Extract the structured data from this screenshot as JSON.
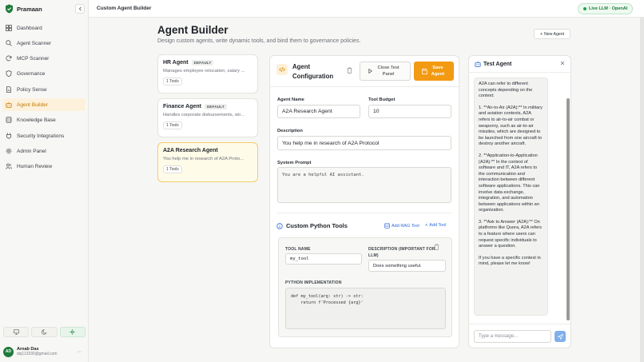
{
  "app": {
    "name": "Pramaan"
  },
  "sidebar": {
    "items": [
      {
        "label": "Dashboard",
        "icon": "dashboard-icon"
      },
      {
        "label": "Agent Scanner",
        "icon": "search-icon"
      },
      {
        "label": "MCP Scanner",
        "icon": "refresh-icon"
      },
      {
        "label": "Governance",
        "icon": "shield-icon"
      },
      {
        "label": "Policy Sense",
        "icon": "document-icon"
      },
      {
        "label": "Agent Builder",
        "icon": "bot-icon",
        "active": true
      },
      {
        "label": "Knowledge Base",
        "icon": "database-icon"
      },
      {
        "label": "Security Integrations",
        "icon": "plug-icon"
      },
      {
        "label": "Admin Panel",
        "icon": "gear-icon"
      },
      {
        "label": "Human Review",
        "icon": "users-icon"
      }
    ],
    "theme_modes": [
      "desktop-icon",
      "moon-icon",
      "sun-icon"
    ],
    "user": {
      "initials": "AD",
      "name": "Arnab Das",
      "email": "dsj113330@gmail.com"
    }
  },
  "topbar": {
    "breadcrumb": "Custom Agent Builder",
    "llm_status": "Live LLM · OpenAI"
  },
  "header": {
    "title": "Agent Builder",
    "subtitle": "Design custom agents, write dynamic tools, and bind them to governance policies.",
    "new_agent_label": "New Agent"
  },
  "agents": [
    {
      "name": "HR Agent",
      "badge": "DEFAULT",
      "desc": "Manages employee relocation, salary ...",
      "tools": "1 Tools"
    },
    {
      "name": "Finance Agent",
      "badge": "DEFAULT",
      "desc": "Handles corporate disbursements, wir...",
      "tools": "1 Tools"
    },
    {
      "name": "A2A Research Agent",
      "badge": "",
      "desc": "You help me in research of A2A Proto...",
      "tools": "1 Tools",
      "selected": true
    }
  ],
  "config": {
    "title": "Agent Configuration",
    "close_label": "Close Test Panel",
    "save_label": "Save Agent",
    "name_label": "Agent Name",
    "name_value": "A2A Research Agent",
    "budget_label": "Tool Budget",
    "budget_value": "10",
    "desc_label": "Description",
    "desc_value": "You help me in research of A2A Protocol",
    "prompt_label": "System Prompt",
    "prompt_value": "You are a helpful AI assistant.",
    "tools_title": "Custom Python Tools",
    "add_rag_label": "Add RAG Tool",
    "add_tool_label": "Add Tool",
    "tool": {
      "name_label": "TOOL NAME",
      "name_value": "my_tool",
      "desc_label": "DESCRIPTION (IMPORTANT FOR LLM)",
      "desc_value": "Does something useful.",
      "impl_label": "PYTHON IMPLEMENTATION",
      "code": "def my_tool(arg: str) -> str:\n    return f'Processed {arg}'"
    }
  },
  "test": {
    "title": "Test Agent",
    "messages": [
      "A2A can refer to different concepts depending on the context:",
      "1. **Air-to-Air (A2A):** In military and aviation contexts, A2A refers to air-to-air combat or weaponry, such as air-to-air missiles, which are designed to be launched from one aircraft to destroy another aircraft.",
      "2. **Application-to-Application (A2A):** In the context of software and IT, A2A refers to the communication and interaction between different software applications. This can involve data exchange, integration, and automation between applications within an organization.",
      "3. **Ask to Answer (A2A):** On platforms like Quora, A2A refers to a feature where users can request specific individuals to answer a question.",
      "If you have a specific context in mind, please let me know!"
    ],
    "input_placeholder": "Type a message..."
  }
}
